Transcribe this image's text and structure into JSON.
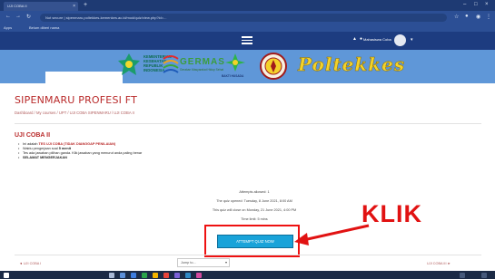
{
  "browser": {
    "tab_title": "UJI COBA II",
    "tab_close": "×",
    "new_tab": "+",
    "url": "Not secure  |  sipenmaru.poltekkes-kemenkes.ac.id/mod/quiz/view.php?id=...",
    "bookmarks": [
      "Apps",
      "Belum diberi nama"
    ]
  },
  "site": {
    "user_name": "Mahasiswa Coba",
    "page_title": "SIPENMARU PROFESI FT",
    "breadcrumb": "Dashboard  /  My courses  /  UPT  /  UJI COBA SIPENMARU  /  UJI COBA II"
  },
  "banner": {
    "kemenkes_text": [
      "KEMENTERIAN",
      "KESEHATAN",
      "REPUBLIK",
      "INDONESIA"
    ],
    "germas_text": "GERMAS",
    "germas_sub": "Gerakan Masyarakat Hidup Sehat",
    "bakti_text": "BAKTI HUSADA",
    "poltekkes_text": "Poltekkes"
  },
  "quiz": {
    "title": "UJI COBA II",
    "instructions": [
      {
        "prefix": "Ini adalah ",
        "red": "TES UJI COBA (TIDAK DIANGGAP PENILAIAN)",
        "suffix": ""
      },
      {
        "prefix": "Waktu pengerjaan soal ",
        "bold": "5 menit",
        "suffix": ""
      },
      {
        "prefix": "Tes ada jawaban pilihan ganda. Klik jawaban yang menurut anda paling benar",
        "bold": "",
        "suffix": ""
      },
      {
        "prefix": "",
        "bold": "SELAMAT MENGERJAKAN",
        "suffix": ""
      }
    ],
    "attempts_allowed": "Attempts allowed: 1",
    "opened": "The quiz opened: Tuesday, 8 June 2021, 8:00 AM",
    "closes": "This quiz will close on Monday, 21 June 2021, 4:00 PM",
    "time_limit": "Time limit: 5 mins",
    "attempt_button": "ATTEMPT QUIZ NOW"
  },
  "annotation": {
    "klik_label": "KLIK"
  },
  "footer": {
    "prev_link": "◄ UJI COBA I",
    "jump_to": "Jump to...",
    "next_link": "UJI COBA III ►"
  },
  "colors": {
    "accent_red": "#b92a2a",
    "button_blue": "#19a3d9",
    "annotation_red": "#e11212",
    "nav_blue": "#1d3c80"
  }
}
